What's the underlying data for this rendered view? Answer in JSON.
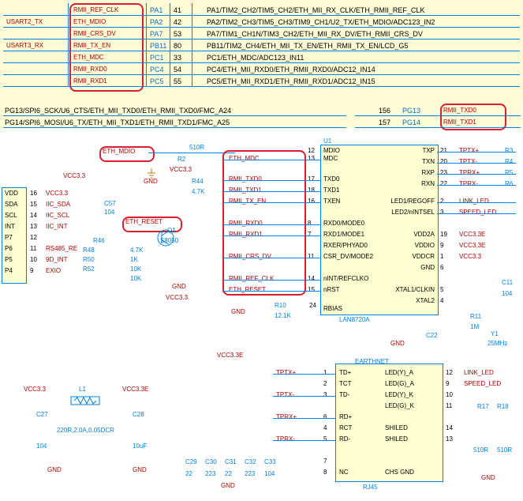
{
  "top_table": {
    "rows": [
      {
        "net": "RMII_REF_CLK",
        "pin": "PA1",
        "num": "41",
        "desc": "PA1/TIM2_CH2/TIM5_CH2/ETH_MII_RX_CLK/ETH_RMII_REF_CLK"
      },
      {
        "net": "ETH_MDIO",
        "pin": "PA2",
        "num": "42",
        "desc": "PA2/TIM2_CH3/TIM5_CH3/TIM9_CH1/U2_TX/ETH_MDIO/ADC123_IN2",
        "left": "USART2_TX"
      },
      {
        "net": "RMII_CRS_DV",
        "pin": "PA7",
        "num": "53",
        "desc": "PA7/TIM1_CH1N/TIM3_CH2/ETH_MII_RX_DV/ETH_RMII_CRS_DV"
      },
      {
        "net": "RMII_TX_EN",
        "pin": "PB11",
        "num": "80",
        "desc": "PB11/TIM2_CH4/ETH_MII_TX_EN/ETH_RMII_TX_EN/LCD_G5",
        "left": "USART3_RX"
      },
      {
        "net": "ETH_MDC",
        "pin": "PC1",
        "num": "33",
        "desc": "PC1/ETH_MDC/ADC123_IN11"
      },
      {
        "net": "RMII_RXD0",
        "pin": "PC4",
        "num": "54",
        "desc": "PC4/ETH_MII_RXD0/ETH_RMII_RXD0/ADC12_IN14"
      },
      {
        "net": "RMII_RXD1",
        "pin": "PC5",
        "num": "55",
        "desc": "PC5/ETH_MII_RXD1/ETH_RMII_RXD1/ADC12_IN15"
      }
    ],
    "below": [
      "PG13/SPI6_SCK/U6_CTS/ETH_MII_TXD0/ETH_RMII_TXD0/FMC_A24",
      "PG14/SPI6_MOSI/U6_TX/ETH_MII_TXD1/ETH_RMII_TXD1/FMC_A25"
    ],
    "right_nets": [
      {
        "num": "156",
        "pin": "PG13",
        "net": "RMII_TXD0"
      },
      {
        "num": "157",
        "pin": "PG14",
        "net": "RMII_TXD1"
      }
    ]
  },
  "left_conn": {
    "header": [
      "VDD",
      "SDA",
      "SCL",
      "INT",
      "P7",
      "P6",
      "P5",
      "P4"
    ],
    "rows": [
      {
        "n": "16",
        "sig": "VCC3.3"
      },
      {
        "n": "15",
        "sig": "IIC_SDA"
      },
      {
        "n": "14",
        "sig": "IIC_SCL"
      },
      {
        "n": "13",
        "sig": "IIC_INT"
      },
      {
        "n": "12"
      },
      {
        "n": "11",
        "sig": "RS485_RE"
      },
      {
        "n": "10",
        "sig": "9D_INT"
      },
      {
        "n": "9",
        "sig": "EXIO"
      }
    ]
  },
  "mid_nets": [
    "ETH_MDIO",
    "ETH_MDC",
    "RMII_TXD0",
    "RMII_TXD1",
    "RMII_TX_EN",
    "RMII_RXD0",
    "RMII_RXD1",
    "RMII_CRS_DV",
    "RMII_REF_CLK",
    "ETH_RESET"
  ],
  "mid_pins": [
    "12",
    "13",
    "17",
    "18",
    "16",
    "8",
    "7",
    "11",
    "14",
    "15"
  ],
  "u1": {
    "ref": "U1",
    "part": "LAN8720A",
    "left": [
      "MDIO",
      "MDC",
      "",
      "TXD0",
      "TXD1",
      "TXEN",
      "",
      "RXD0/MODE0",
      "RXD1/MODE1",
      "RXER/PHYAD0",
      "CSR_DV/MODE2",
      "",
      "nINT/REFCLKO",
      "nRST",
      "",
      "RBIAS"
    ],
    "right": [
      "TXP",
      "TXN",
      "RXP",
      "RXN",
      "",
      "LED1/REGOFF",
      "LED2/nINTSEL",
      "",
      "VDD2A",
      "VDDIO",
      "VDDCR",
      "GND",
      "",
      "XTAL1/CLKIN",
      "XTAL2"
    ],
    "rpn": [
      "21",
      "20",
      "23",
      "22",
      "",
      "2",
      "3",
      "",
      "19",
      "9",
      "1",
      "6",
      "",
      "5",
      "4"
    ]
  },
  "r_nets": [
    "TPTX+",
    "TPTX-",
    "TPRX+",
    "TPRX-",
    "",
    "LINK_LED",
    "SPEED_LED",
    "",
    "VCC3.3E",
    "VCC3.3E",
    "VCC3.3"
  ],
  "parts": {
    "r2": "510R",
    "vcc33": "VCC3.3",
    "gnd": "GND",
    "r44": "4.7K",
    "c57": "104",
    "eth_reset": "ETH_RESET",
    "q1": "Q1",
    "s8050": "S8050",
    "r46": "R46",
    "r48": "R48",
    "r50": "R50",
    "r52": "R52",
    "v47k": "4.7K",
    "v1k": "1K",
    "v10k": "10K",
    "r10": "R10",
    "r12": "12.1K",
    "c22": "C22",
    "y1": "Y1",
    "y1v": "25MHz",
    "r11": "R11",
    "r11v": "1M",
    "c11": "C11",
    "c11v": "104",
    "vcc33e": "VCC3.3E",
    "l1": "L1",
    "l1v": "220R,2.0A,0.05DCR",
    "c27": "C27",
    "c27v": "104",
    "c28": "C28",
    "c28v": "10uF",
    "c29": "C29",
    "c30": "C30",
    "c31": "C31",
    "c32": "C32",
    "c33": "C33",
    "c2v": "22",
    "c3v": "223",
    "c10v": "104",
    "rj45": "RJ45",
    "earthnet": "EARTHNET",
    "r17": "R17",
    "r18": "R18",
    "r510": "510R"
  },
  "rj_pins_left": [
    "1",
    "2",
    "3",
    "6",
    "4",
    "5",
    "7",
    "8"
  ],
  "rj_lbl_left": [
    "TD+",
    "TCT",
    "TD-",
    "RD+",
    "RCT",
    "RD-",
    "",
    "NC"
  ],
  "rj_lbl_right": [
    "LED(Y)_A",
    "LED(G)_A",
    "LED(Y)_K",
    "LED(G)_K",
    "",
    "SHILED",
    "SHILED",
    "",
    "CHS GND"
  ],
  "rj_rpn": [
    "12",
    "9",
    "10",
    "11",
    "",
    "14",
    "13",
    ""
  ],
  "rj_nets_in": [
    "TPTX+",
    "TPTX-",
    "TPRX+",
    "TPRX-"
  ]
}
